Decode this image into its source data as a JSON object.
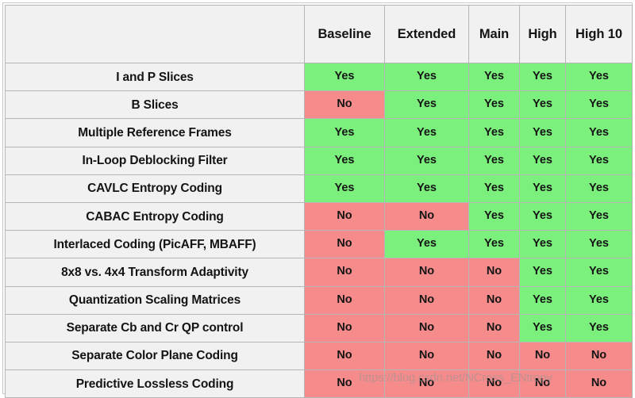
{
  "table": {
    "feature_header": "",
    "columns": [
      "Baseline",
      "Extended",
      "Main",
      "High",
      "High 10"
    ],
    "rows": [
      {
        "feature": "I and P Slices",
        "values": [
          "Yes",
          "Yes",
          "Yes",
          "Yes",
          "Yes"
        ]
      },
      {
        "feature": "B Slices",
        "values": [
          "No",
          "Yes",
          "Yes",
          "Yes",
          "Yes"
        ]
      },
      {
        "feature": "Multiple Reference Frames",
        "values": [
          "Yes",
          "Yes",
          "Yes",
          "Yes",
          "Yes"
        ]
      },
      {
        "feature": "In-Loop Deblocking Filter",
        "values": [
          "Yes",
          "Yes",
          "Yes",
          "Yes",
          "Yes"
        ]
      },
      {
        "feature": "CAVLC Entropy Coding",
        "values": [
          "Yes",
          "Yes",
          "Yes",
          "Yes",
          "Yes"
        ]
      },
      {
        "feature": "CABAC Entropy Coding",
        "values": [
          "No",
          "No",
          "Yes",
          "Yes",
          "Yes"
        ]
      },
      {
        "feature": "Interlaced Coding (PicAFF, MBAFF)",
        "values": [
          "No",
          "Yes",
          "Yes",
          "Yes",
          "Yes"
        ]
      },
      {
        "feature": "8x8 vs. 4x4 Transform Adaptivity",
        "values": [
          "No",
          "No",
          "No",
          "Yes",
          "Yes"
        ]
      },
      {
        "feature": "Quantization Scaling Matrices",
        "values": [
          "No",
          "No",
          "No",
          "Yes",
          "Yes"
        ]
      },
      {
        "feature": "Separate Cb and Cr QP control",
        "values": [
          "No",
          "No",
          "No",
          "Yes",
          "Yes"
        ]
      },
      {
        "feature": "Separate Color Plane Coding",
        "values": [
          "No",
          "No",
          "No",
          "No",
          "No"
        ]
      },
      {
        "feature": "Predictive Lossless Coding",
        "values": [
          "No",
          "No",
          "No",
          "No",
          "No"
        ]
      }
    ]
  },
  "watermark": {
    "text": "https://blog.csdn.net/NCross_ENtropy"
  },
  "colors": {
    "yes_background": "#7cf07c",
    "no_background": "#f68b8b",
    "cell_background": "#f1f1f1",
    "grid_line": "#b6b6b6",
    "text": "#141414"
  }
}
